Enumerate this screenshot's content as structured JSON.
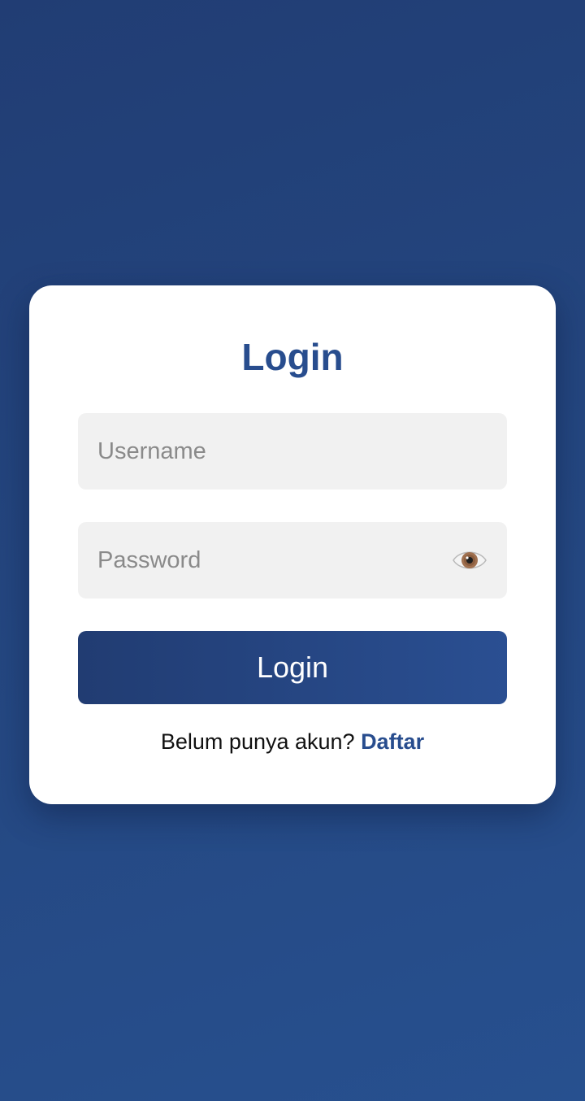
{
  "login": {
    "title": "Login",
    "username": {
      "placeholder": "Username",
      "value": ""
    },
    "password": {
      "placeholder": "Password",
      "value": "",
      "toggle_icon": "eye-icon"
    },
    "submit_label": "Login",
    "register_prompt": "Belum punya akun?",
    "register_link": "Daftar"
  },
  "colors": {
    "background_start": "#213d74",
    "background_end": "#27508f",
    "accent": "#284d8e",
    "button_start": "#213c72",
    "button_end": "#2a4f92",
    "input_background": "#f1f1f1"
  }
}
